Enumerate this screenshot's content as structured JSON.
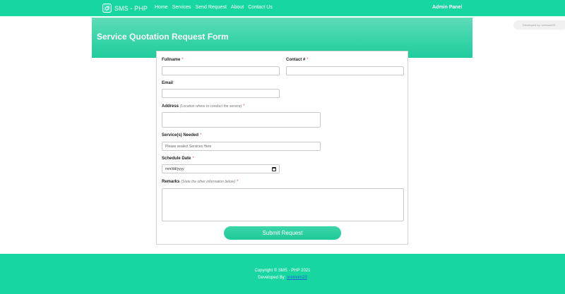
{
  "navbar": {
    "brand": "SMS - PHP",
    "links": [
      "Home",
      "Services",
      "Send Request",
      "About",
      "Contact Us"
    ],
    "admin": "Admin Panel"
  },
  "header": {
    "title": "Service Quotation Request Form"
  },
  "dev_badge": "Developed by: oretnom23",
  "form": {
    "fullname_label": "Fullname",
    "contact_label": "Contact #",
    "email_label": "Email",
    "address_label": "Address",
    "address_hint": "(Location where to conduct the service)",
    "services_label": "Service(s) Needed",
    "services_placeholder": "Please sealect Services Here",
    "schedule_label": "Schedule Date",
    "schedule_value": "mm/dd/yyyy",
    "remarks_label": "Remarks",
    "remarks_hint": "(State the other information below)",
    "required_mark": "*",
    "submit": "Submit Request"
  },
  "footer": {
    "copyright": "Copyright © SMS - PHP 2021",
    "developed_by": "Developed By:",
    "developer": "oretnom23"
  },
  "colors": {
    "primary": "#17d6a0",
    "required": "#e04b4b",
    "link": "#1a64d8"
  }
}
